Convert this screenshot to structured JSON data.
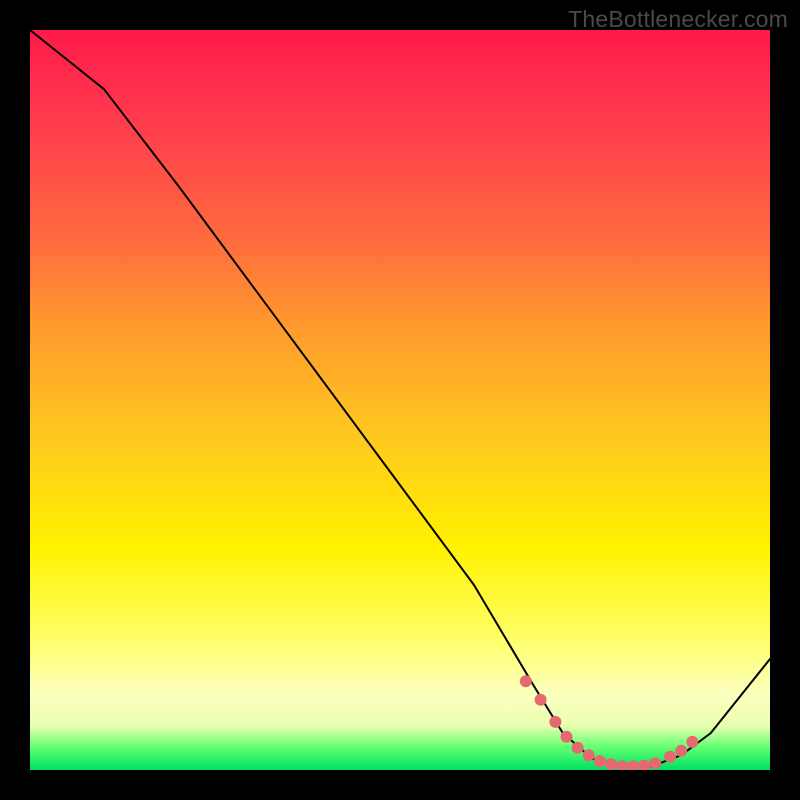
{
  "attribution": "TheBottlenecker.com",
  "chart_data": {
    "type": "line",
    "title": "",
    "xlabel": "",
    "ylabel": "",
    "xlim": [
      0,
      100
    ],
    "ylim": [
      0,
      100
    ],
    "series": [
      {
        "name": "curve",
        "x": [
          0,
          10,
          20,
          30,
          40,
          50,
          60,
          68,
          72,
          76,
          80,
          84,
          88,
          92,
          100
        ],
        "y": [
          100,
          92,
          79,
          65.5,
          52,
          38.5,
          25,
          11.5,
          5,
          1.5,
          0.5,
          0.5,
          2,
          5,
          15
        ]
      }
    ],
    "highlight_points": {
      "x": [
        67,
        69,
        71,
        72.5,
        74,
        75.5,
        77,
        78.5,
        80,
        81.5,
        83,
        84.5,
        86.5,
        88,
        89.5
      ],
      "y": [
        12,
        9.5,
        6.5,
        4.5,
        3,
        2,
        1.2,
        0.8,
        0.5,
        0.5,
        0.6,
        0.9,
        1.8,
        2.6,
        3.8
      ]
    }
  }
}
